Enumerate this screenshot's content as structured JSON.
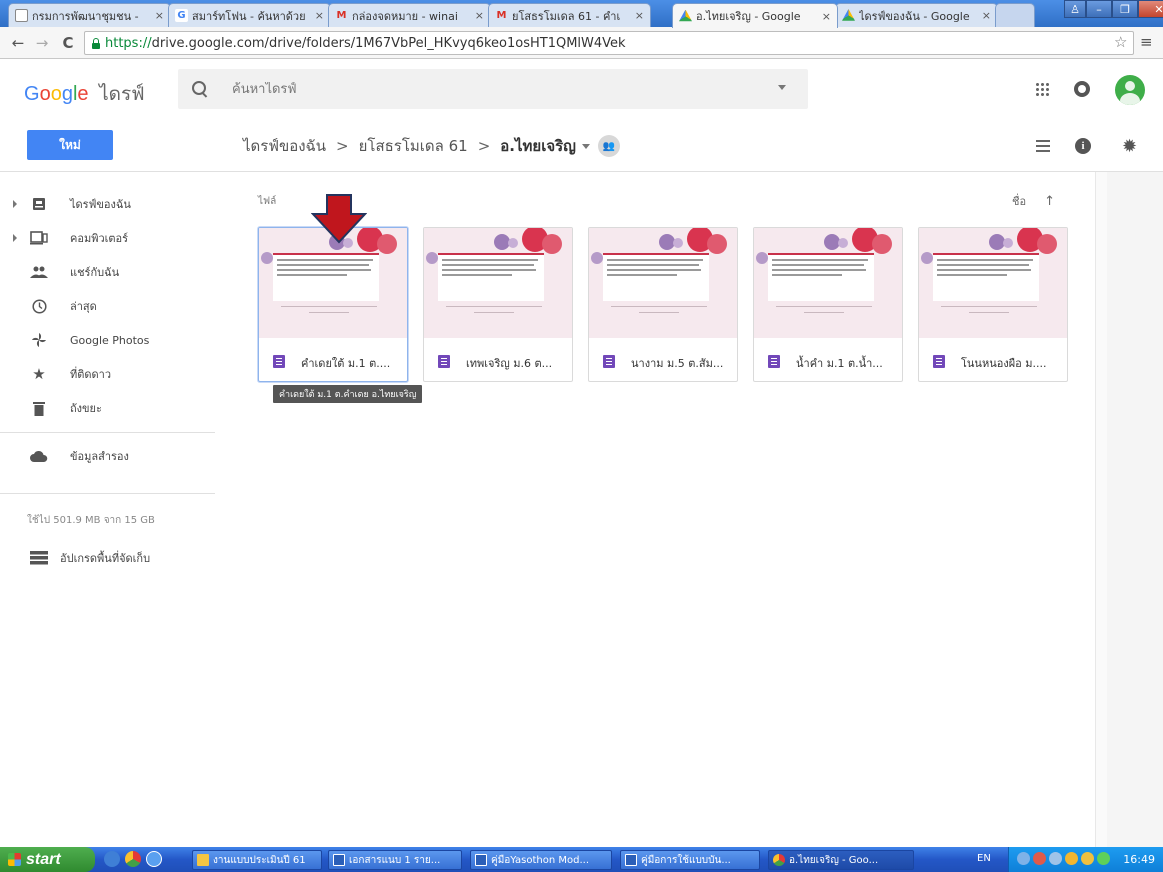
{
  "browser": {
    "tabs": [
      {
        "title": "กรมการพัฒนาชุมชน - ",
        "favicon": "page-icon"
      },
      {
        "title": "สมาร์ทโฟน - ค้นหาด้วย",
        "favicon": "google-icon"
      },
      {
        "title": "กล่องจดหมาย - winai",
        "favicon": "gmail-icon"
      },
      {
        "title": "ยโสธรโมเดล 61 - คำเ",
        "favicon": "gmail-icon"
      },
      {
        "title": "อ.ไทยเจริญ - Google",
        "favicon": "drive-icon",
        "active": true
      },
      {
        "title": "ไดรฟ์ของฉัน - Google",
        "favicon": "drive-icon"
      }
    ],
    "url_scheme": "https://",
    "url_rest": "drive.google.com/drive/folders/1M67VbPel_HKvyq6keo1osHT1QMlW4Vek"
  },
  "drive": {
    "logo_text": [
      "G",
      "o",
      "o",
      "g",
      "l",
      "e"
    ],
    "product": "ไดรฟ์",
    "search_placeholder": "ค้นหาไดรฟ์",
    "new_button": "ใหม่",
    "breadcrumb": {
      "root": "ไดรฟ์ของฉัน",
      "parent": "ยโสธรโมเดล 61",
      "current": "อ.ไทยเจริญ",
      "sep": ">"
    },
    "section_label": "ไฟล์",
    "sort_label": "ชื่อ",
    "sort_arrow": "↑"
  },
  "sidebar": {
    "items": [
      {
        "label": "ไดรฟ์ของฉัน",
        "icon": "drive-icon",
        "expandable": true
      },
      {
        "label": "คอมพิวเตอร์",
        "icon": "computer-icon",
        "expandable": true
      },
      {
        "label": "แชร์กับฉัน",
        "icon": "people-icon"
      },
      {
        "label": "ล่าสุด",
        "icon": "clock-icon"
      },
      {
        "label": "Google Photos",
        "icon": "pinwheel-icon"
      },
      {
        "label": "ที่ติดดาว",
        "icon": "star-icon"
      },
      {
        "label": "ถังขยะ",
        "icon": "trash-icon"
      }
    ],
    "backup": {
      "label": "ข้อมูลสำรอง",
      "icon": "cloud-icon"
    },
    "quota": "ใช้ไป 501.9 MB จาก 15 GB",
    "upgrade": {
      "label": "อัปเกรดพื้นที่จัดเก็บ",
      "icon": "storage-icon"
    }
  },
  "files": [
    {
      "name": "คำเดยใต้ ม.1 ต....",
      "type": "form",
      "selected": true
    },
    {
      "name": "เทพเจริญ ม.6 ต...",
      "type": "form"
    },
    {
      "name": "นางาม ม.5 ต.สัม...",
      "type": "form"
    },
    {
      "name": "น้ำคำ ม.1 ต.น้ำ...",
      "type": "form"
    },
    {
      "name": "โนนหนองผือ ม....",
      "type": "form"
    }
  ],
  "tooltip": "คำเดยใต้ ม.1 ต.คำเดย อ.ไทยเจริญ",
  "taskbar": {
    "start": "start",
    "buttons": [
      {
        "label": "งานแบบประเมินปี 61",
        "icon": "folder-icon"
      },
      {
        "label": "เอกสารแนบ 1 ราย...",
        "icon": "word-icon"
      },
      {
        "label": "คู่มือYasothon Mod...",
        "icon": "word-icon"
      },
      {
        "label": "คู่มือการใช้แบบบัน...",
        "icon": "word-icon"
      },
      {
        "label": "อ.ไทยเจริญ - Goo...",
        "icon": "chrome-icon",
        "active": true
      }
    ],
    "lang": "EN",
    "time": "16:49"
  }
}
